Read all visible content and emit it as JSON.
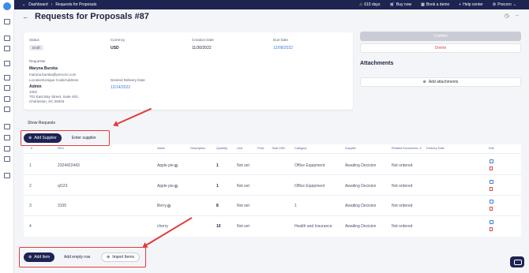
{
  "topbar": {
    "dashboard": "Dashboard",
    "sep": "›",
    "page": "Requests for Proposals",
    "days": "610 days",
    "buy": "Buy now",
    "demo": "Book a demo",
    "help": "Help center",
    "user": "Precoro"
  },
  "header": {
    "title": "Requests for Proposals #87"
  },
  "info": {
    "status_label": "Status",
    "status": "Draft",
    "currency_label": "Currency",
    "currency": "USD",
    "creation_label": "Creation Date",
    "creation": "11/30/2022",
    "due_label": "Due Date",
    "due": "12/08/2022",
    "requester_label": "Requester",
    "requester_name": "Maryna Burska",
    "requester_email": "maryna.burska@precoro.com",
    "location_label": "Location/Unique Code/Address",
    "location_name": "Admin",
    "location_code": "1002",
    "location_addr1": "701 East Bay Street, Suite 402,",
    "location_addr2": "Charleston, SC 29403",
    "delivery_label": "Desired Delivery Date",
    "delivery": "12/14/2022"
  },
  "actions": {
    "confirm": "Confirm",
    "delete": "Delete",
    "attachments_title": "Attachments",
    "add_attachments": "Add attachments"
  },
  "show_requests": "Show Requests",
  "supplier": {
    "add": "Add Supplier",
    "enter": "Enter supplier"
  },
  "table": {
    "headers": [
      "#",
      "SKU",
      "Name",
      "Description",
      "Quantity",
      "Unit",
      "Price",
      "Total USD",
      "Category",
      "Supplier",
      "Related Documents, #",
      "Delivery Date",
      "Edit"
    ],
    "rows": [
      {
        "num": "1",
        "sku": "2324422443",
        "name": "Apple pie",
        "qty": "1",
        "unit": "Not set",
        "category": "Office Equipment",
        "supplier": "Awaiting Decision",
        "related": "Not ordered"
      },
      {
        "num": "2",
        "sku": "ql123",
        "name": "Apple pie",
        "qty": "1",
        "unit": "Not set",
        "category": "Office Equipment",
        "supplier": "Awaiting Decision",
        "related": "Not ordered"
      },
      {
        "num": "3",
        "sku": "3105",
        "name": "Berry",
        "qty": "8",
        "unit": "Not set",
        "category": "1",
        "supplier": "Awaiting Decision",
        "related": "Not ordered"
      },
      {
        "num": "4",
        "sku": "",
        "name": "cherry",
        "qty": "10",
        "unit": "Not set",
        "category": "Health and Insurance",
        "supplier": "Awaiting Decision",
        "related": "Not ordered"
      }
    ]
  },
  "items": {
    "add": "Add Item",
    "empty": "Add empty row",
    "import": "Import Items"
  },
  "colors": {
    "navy": "#1d2452",
    "accent": "#3d7be0",
    "danger": "#e24a4a",
    "annotation": "#e03b3b"
  }
}
